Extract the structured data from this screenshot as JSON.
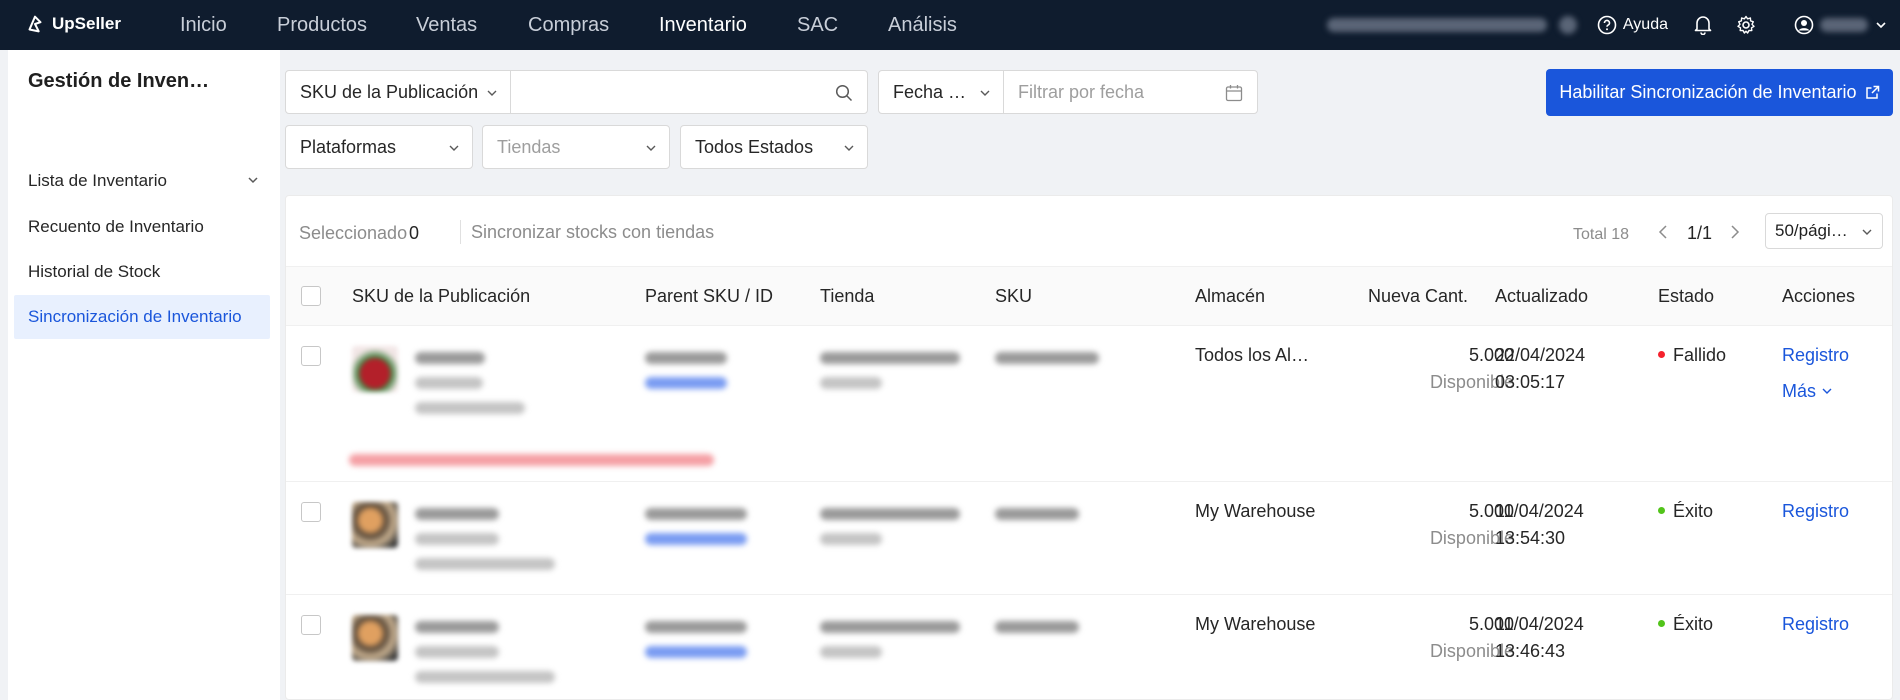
{
  "app": {
    "brand": "UpSeller"
  },
  "nav": {
    "items": [
      "Inicio",
      "Productos",
      "Ventas",
      "Compras",
      "Inventario",
      "SAC",
      "Análisis"
    ],
    "active": "Inventario",
    "help_label": "Ayuda"
  },
  "sidebar": {
    "title": "Gestión de Inven…",
    "items": [
      {
        "label": "Lista de Inventario"
      },
      {
        "label": "Recuento de Inventario"
      },
      {
        "label": "Historial de Stock"
      },
      {
        "label": "Sincronización de Inventario"
      }
    ]
  },
  "filters": {
    "sku_type": "SKU de la Publicación",
    "search_placeholder": "",
    "date_type": "Fecha …",
    "date_placeholder": "Filtrar por fecha",
    "platforms": "Plataformas",
    "stores_placeholder": "Tiendas",
    "status": "Todos Estados"
  },
  "sync_button": "Habilitar Sincronización de Inventario",
  "toolbar": {
    "selected_label": "Seleccionado",
    "selected_count": "0",
    "sync_stocks": "Sincronizar stocks con tiendas",
    "total": "Total 18",
    "page": "1/1",
    "page_size": "50/pági…"
  },
  "table": {
    "headers": [
      "SKU de la Publicación",
      "Parent SKU / ID",
      "Tienda",
      "SKU",
      "Almacén",
      "Nueva Cant.",
      "Actualizado",
      "Estado",
      "Acciones"
    ],
    "rows": [
      {
        "warehouse": "Todos los Al…",
        "qty": "5.000",
        "qty_label": "Disponible",
        "date": "22/04/2024",
        "time": "03:05:17",
        "status": "Fallido",
        "action": "Registro",
        "more": "Más"
      },
      {
        "warehouse": "My Warehouse",
        "qty": "5.000",
        "qty_label": "Disponible",
        "date": "11/04/2024",
        "time": "13:54:30",
        "status": "Éxito",
        "action": "Registro"
      },
      {
        "warehouse": "My Warehouse",
        "qty": "5.000",
        "qty_label": "Disponible",
        "date": "11/04/2024",
        "time": "13:46:43",
        "status": "Éxito",
        "action": "Registro"
      }
    ]
  },
  "colors": {
    "nav_bg": "#0f1c2e",
    "primary": "#1a56db",
    "fail": "#f5222d",
    "success": "#52c41a"
  }
}
